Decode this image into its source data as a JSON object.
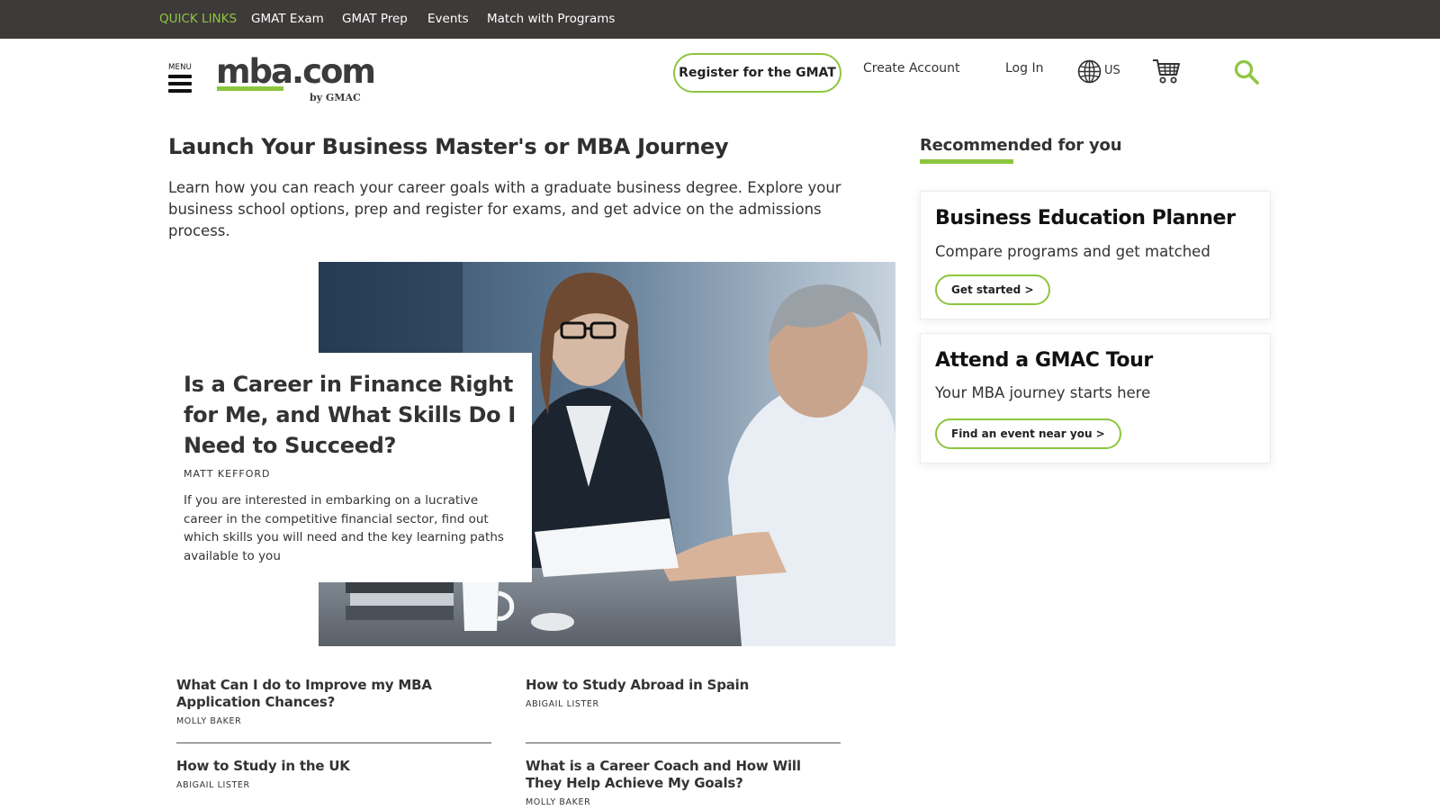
{
  "quick_links": {
    "label": "QUICK LINKS",
    "items": [
      "GMAT Exam",
      "GMAT Prep",
      "Events",
      "Match with Programs"
    ]
  },
  "header": {
    "menu_label": "MENU",
    "logo_text": "mba.com",
    "logo_sub": "by GMAC",
    "register_label": "Register for the GMAT",
    "create_account_label": "Create Account",
    "login_label": "Log In",
    "region": "US",
    "icons": [
      "menu-icon",
      "globe-icon",
      "cart-icon",
      "search-icon"
    ]
  },
  "main": {
    "title": "Launch Your Business Master's or MBA Journey",
    "intro": "Learn how you can reach your career goals with a graduate business degree. Explore your business school options, prep and register for exams, and get advice on the admissions process.",
    "featured": {
      "title": "Is a Career in Finance Right for Me, and What Skills Do I Need to Succeed?",
      "author": "MATT KEFFORD",
      "description": "If you are interested in embarking on a lucrative career in the competitive financial sector, find out which skills you will need and the key learning paths available to you"
    },
    "articles": [
      {
        "title": "What Can I do to Improve my MBA Application Chances?",
        "author": "MOLLY BAKER"
      },
      {
        "title": "How to Study Abroad in Spain",
        "author": "ABIGAIL LISTER"
      },
      {
        "title": "How to Study in the UK",
        "author": "ABIGAIL LISTER"
      },
      {
        "title": "What is a Career Coach and How Will They Help Achieve My Goals?",
        "author": "MOLLY BAKER"
      }
    ]
  },
  "sidebar": {
    "title": "Recommended for you",
    "cards": [
      {
        "title": "Business Education Planner",
        "subtitle": "Compare programs and get matched",
        "button": "Get started >"
      },
      {
        "title": "Attend a GMAC Tour",
        "subtitle": "Your MBA journey starts here",
        "button": "Find an event near you >"
      }
    ]
  },
  "colors": {
    "accent": "#8cc63f",
    "topbar": "#3e3a39",
    "text": "#333333"
  }
}
